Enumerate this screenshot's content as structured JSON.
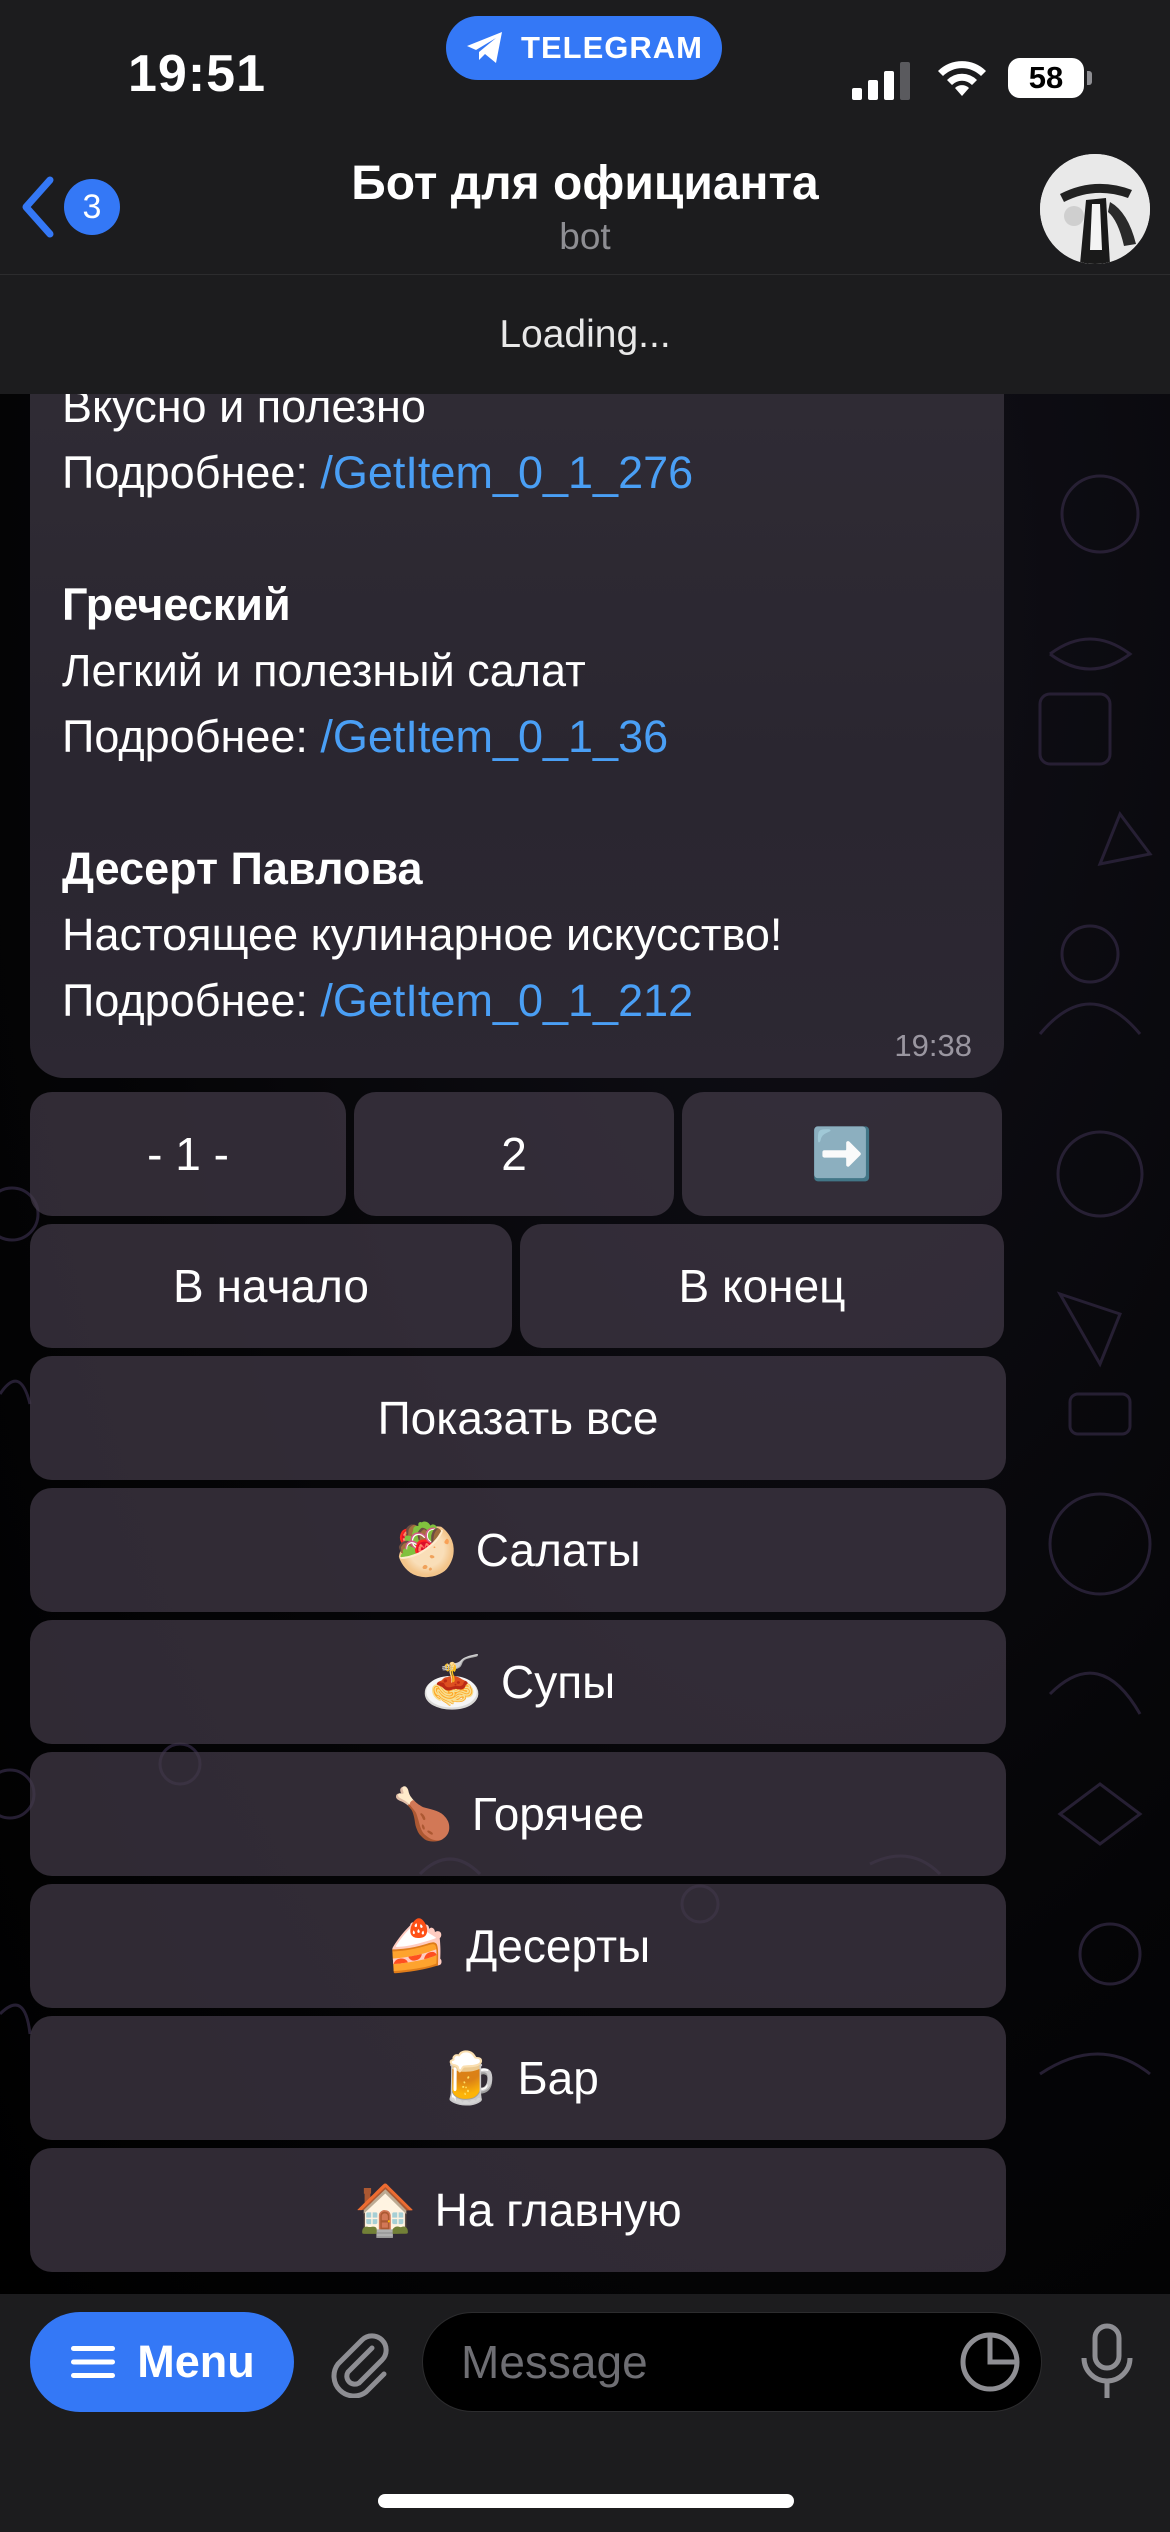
{
  "status_bar": {
    "time": "19:51",
    "app_pill": "TELEGRAM",
    "battery": "58"
  },
  "header": {
    "back_badge": "3",
    "title": "Бот для официанта",
    "subtitle": "bot",
    "loading": "Loading..."
  },
  "message": {
    "lines": [
      {
        "text": "Вкусно и полезно"
      },
      {
        "prefix": "Подробнее: ",
        "link": "/GetItem_0_1_276"
      },
      {
        "title": "Греческий"
      },
      {
        "text": "Легкий и полезный салат"
      },
      {
        "prefix": "Подробнее: ",
        "link": "/GetItem_0_1_36"
      },
      {
        "title": "Десерт Павлова"
      },
      {
        "text": "Настоящее кулинарное искусство!"
      },
      {
        "prefix": "Подробнее: ",
        "link": "/GetItem_0_1_212"
      }
    ],
    "time": "19:38"
  },
  "keyboard": {
    "page_current": "- 1 -",
    "page_2": "2",
    "next_emoji": "➡️",
    "to_start": "В начало",
    "to_end": "В конец",
    "show_all": "Показать все",
    "categories": [
      {
        "emoji": "🥙",
        "label": "Салаты"
      },
      {
        "emoji": "🍝",
        "label": "Супы"
      },
      {
        "emoji": "🍗",
        "label": "Горячее"
      },
      {
        "emoji": "🍰",
        "label": "Десерты"
      },
      {
        "emoji": "🍺",
        "label": "Бар"
      },
      {
        "emoji": "🏠",
        "label": "На главную"
      }
    ]
  },
  "input_bar": {
    "menu_label": "Menu",
    "placeholder": "Message"
  },
  "colors": {
    "accent": "#3478f6",
    "link": "#4a9ff5",
    "bubble": "#2d2833",
    "bar": "#1c1c1e"
  }
}
